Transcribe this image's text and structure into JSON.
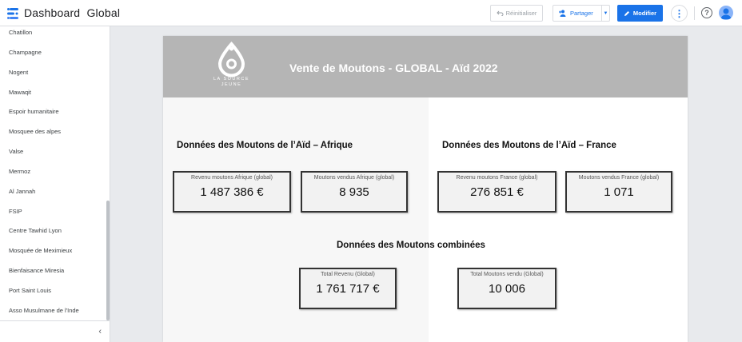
{
  "app": {
    "title": "Dashboard  Global",
    "reset_label": "Réinitialiser",
    "share_label": "Partager",
    "edit_label": "Modifier"
  },
  "sidebar": {
    "items": [
      {
        "label": "Chatillon"
      },
      {
        "label": "Champagne"
      },
      {
        "label": "Nogent"
      },
      {
        "label": "Mawaqit"
      },
      {
        "label": "Espoir humanitaire"
      },
      {
        "label": "Mosquee des alpes"
      },
      {
        "label": "Valse"
      },
      {
        "label": "Mermoz"
      },
      {
        "label": "Al Jannah"
      },
      {
        "label": "FSIP"
      },
      {
        "label": "Centre Tawhid Lyon"
      },
      {
        "label": "Mosquée de Meximieux"
      },
      {
        "label": "Bienfaisance Miresia"
      },
      {
        "label": "Port Saint Louis"
      },
      {
        "label": "Asso Musulmane de l'Inde"
      }
    ]
  },
  "report": {
    "brand": "LA SOURCE\nJEUNE",
    "title": "Vente de Moutons - GLOBAL - Aïd 2022",
    "section_afrique": "Données des Moutons de l’Aïd – Afrique",
    "section_france": "Données des Moutons de l’Aïd – France",
    "section_combined": "Données des Moutons combinées",
    "kpi_revenu_afrique": {
      "label": "Revenu moutons Afrique (global)",
      "value": "1 487 386 €"
    },
    "kpi_vendus_afrique": {
      "label": "Moutons vendus Afrique (global)",
      "value": "8 935"
    },
    "kpi_revenu_france": {
      "label": "Revenu moutons France (global)",
      "value": "276 851 €"
    },
    "kpi_vendus_france": {
      "label": "Moutons vendus France (global)",
      "value": "1 071"
    },
    "kpi_total_revenu": {
      "label": "Total Revenu (Global)",
      "value": "1 761 717 €"
    },
    "kpi_total_vendu": {
      "label": "Total Moutons vendu (Global)",
      "value": "10 006"
    }
  },
  "colors": {
    "accent": "#1a73e8",
    "header_bg": "#b5b5b5"
  },
  "icons": [
    "dashboard-logo-icon",
    "undo-icon",
    "add-person-icon",
    "pencil-icon",
    "more-vert-icon",
    "help-icon",
    "account-icon",
    "chevron-left-icon",
    "drop-logo-icon"
  ]
}
